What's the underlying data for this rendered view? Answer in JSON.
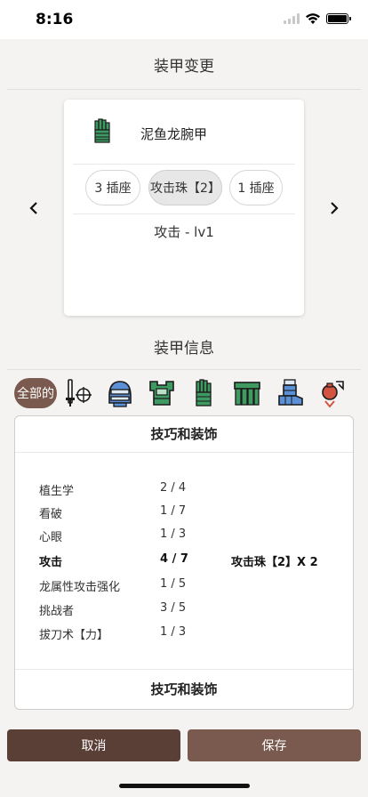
{
  "status_bar": {
    "time": "8:16"
  },
  "header": {
    "title": "装甲变更"
  },
  "armor_card": {
    "name": "泥鱼龙腕甲",
    "slots": [
      {
        "label": "3 插座",
        "selected": false
      },
      {
        "label": "攻击珠【2】",
        "selected": true
      },
      {
        "label": "1 插座",
        "selected": false
      }
    ],
    "skill": "攻击 - lv1"
  },
  "armor_info": {
    "title": "装甲信息",
    "filter_all_label": "全部的",
    "filters": [
      "weapon-icon",
      "helmet-icon",
      "chest-icon",
      "gauntlet-icon",
      "waist-icon",
      "legs-icon",
      "charm-icon"
    ]
  },
  "skills_panel": {
    "header": "技巧和装饰",
    "footer": "技巧和装饰",
    "rows": [
      {
        "name": "植生学",
        "level": "2 / 4",
        "deco": ""
      },
      {
        "name": "看破",
        "level": "1 / 7",
        "deco": ""
      },
      {
        "name": "心眼",
        "level": "1 / 3",
        "deco": ""
      },
      {
        "name": "攻击",
        "level": "4 / 7",
        "deco": "攻击珠【2】X 2"
      },
      {
        "name": "龙属性攻击强化",
        "level": "1 / 5",
        "deco": ""
      },
      {
        "name": "挑战者",
        "level": "3 / 5",
        "deco": ""
      },
      {
        "name": "拔刀术【力】",
        "level": "1 / 3",
        "deco": ""
      }
    ]
  },
  "actions": {
    "cancel": "取消",
    "save": "保存"
  },
  "colors": {
    "primary": "#7a5a4e",
    "primary_dark": "#5a3f37",
    "armor_green": "#3f9a62"
  }
}
